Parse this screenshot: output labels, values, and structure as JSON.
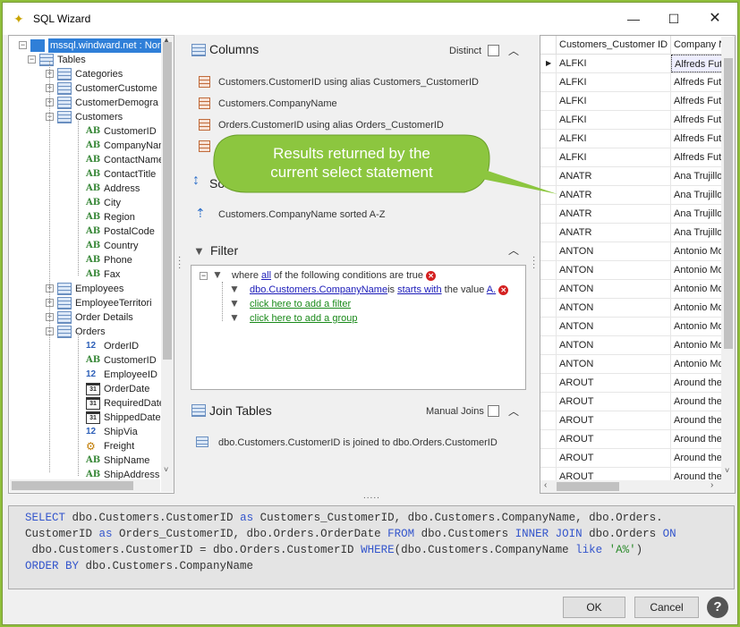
{
  "window": {
    "title": "SQL Wizard",
    "controls": [
      "minimize",
      "maximize",
      "close"
    ]
  },
  "tree": {
    "root": "mssql.windward.net : Nor",
    "tables_label": "Tables",
    "tables": [
      "Categories",
      "CustomerCustome",
      "CustomerDemogra",
      "Customers"
    ],
    "customers_columns": [
      {
        "label": "CustomerID",
        "type": "text"
      },
      {
        "label": "CompanyName",
        "type": "text"
      },
      {
        "label": "ContactName",
        "type": "text"
      },
      {
        "label": "ContactTitle",
        "type": "text"
      },
      {
        "label": "Address",
        "type": "text"
      },
      {
        "label": "City",
        "type": "text"
      },
      {
        "label": "Region",
        "type": "text"
      },
      {
        "label": "PostalCode",
        "type": "text"
      },
      {
        "label": "Country",
        "type": "text"
      },
      {
        "label": "Phone",
        "type": "text"
      },
      {
        "label": "Fax",
        "type": "text"
      }
    ],
    "tables_after": [
      "Employees",
      "EmployeeTerritori",
      "Order Details",
      "Orders"
    ],
    "orders_columns": [
      {
        "label": "OrderID",
        "type": "number"
      },
      {
        "label": "CustomerID",
        "type": "text"
      },
      {
        "label": "EmployeeID",
        "type": "number"
      },
      {
        "label": "OrderDate",
        "type": "date"
      },
      {
        "label": "RequiredDate",
        "type": "date"
      },
      {
        "label": "ShippedDate",
        "type": "date"
      },
      {
        "label": "ShipVia",
        "type": "number"
      },
      {
        "label": "Freight",
        "type": "money"
      },
      {
        "label": "ShipName",
        "type": "text"
      },
      {
        "label": "ShipAddress",
        "type": "text"
      }
    ]
  },
  "columns": {
    "heading": "Columns",
    "distinct_label": "Distinct",
    "items": [
      "Customers.CustomerID using alias Customers_CustomerID",
      "Customers.CompanyName",
      "Orders.CustomerID using alias Orders_CustomerID",
      "O"
    ]
  },
  "sort": {
    "heading": "So",
    "item": "Customers.CompanyName sorted A-Z"
  },
  "filter": {
    "heading": "Filter",
    "where_prefix": "where",
    "where_all": "all",
    "where_suffix": "of the following conditions are true",
    "condition_field": "dbo.Customers.CompanyName",
    "condition_is": "is",
    "condition_op": "starts with",
    "condition_value_prefix": "the value",
    "condition_value": "A.",
    "add_filter": "click here to add a filter",
    "add_group": "click here to add a group"
  },
  "join": {
    "heading": "Join Tables",
    "manual_label": "Manual Joins",
    "item": "dbo.Customers.CustomerID is joined to dbo.Orders.CustomerID"
  },
  "grid": {
    "headers": [
      "Customers_Customer ID",
      "Company Nam"
    ],
    "rows": [
      [
        "ALFKI",
        "Alfreds Fut"
      ],
      [
        "ALFKI",
        "Alfreds Fut"
      ],
      [
        "ALFKI",
        "Alfreds Fut"
      ],
      [
        "ALFKI",
        "Alfreds Fut"
      ],
      [
        "ALFKI",
        "Alfreds Fut"
      ],
      [
        "ALFKI",
        "Alfreds Fut"
      ],
      [
        "ANATR",
        "Ana Trujillo"
      ],
      [
        "ANATR",
        "Ana Trujillo"
      ],
      [
        "ANATR",
        "Ana Trujillo"
      ],
      [
        "ANATR",
        "Ana Trujillo"
      ],
      [
        "ANTON",
        "Antonio Mo"
      ],
      [
        "ANTON",
        "Antonio Mo"
      ],
      [
        "ANTON",
        "Antonio Mo"
      ],
      [
        "ANTON",
        "Antonio Mo"
      ],
      [
        "ANTON",
        "Antonio Mo"
      ],
      [
        "ANTON",
        "Antonio Mo"
      ],
      [
        "ANTON",
        "Antonio Mo"
      ],
      [
        "AROUT",
        "Around the"
      ],
      [
        "AROUT",
        "Around the"
      ],
      [
        "AROUT",
        "Around the"
      ],
      [
        "AROUT",
        "Around the"
      ],
      [
        "AROUT",
        "Around the"
      ],
      [
        "AROUT",
        "Around the"
      ]
    ]
  },
  "callout": {
    "line1": "Results returned by the",
    "line2": "current select statement",
    "color": "#8cc63f"
  },
  "sql": {
    "line1": [
      [
        "kw",
        "SELECT"
      ],
      [
        "t",
        " dbo.Customers.CustomerID "
      ],
      [
        "kw",
        "as"
      ],
      [
        "t",
        " Customers_CustomerID, dbo.Customers.CompanyName, dbo.Orders."
      ]
    ],
    "line2": [
      [
        "t",
        "CustomerID "
      ],
      [
        "kw",
        "as"
      ],
      [
        "t",
        " Orders_CustomerID, dbo.Orders.OrderDate "
      ],
      [
        "kw",
        "FROM"
      ],
      [
        "t",
        " dbo.Customers "
      ],
      [
        "kw",
        "INNER JOIN"
      ],
      [
        "t",
        " dbo.Orders "
      ],
      [
        "kw",
        "ON"
      ]
    ],
    "line3": [
      [
        "t",
        " dbo.Customers.CustomerID = dbo.Orders.CustomerID "
      ],
      [
        "kw",
        "WHERE"
      ],
      [
        "t",
        "(dbo.Customers.CompanyName "
      ],
      [
        "kw",
        "like"
      ],
      [
        "t",
        " "
      ],
      [
        "st",
        "'A%'"
      ],
      [
        "t",
        ")"
      ]
    ],
    "line4": [
      [
        "kw",
        "ORDER BY"
      ],
      [
        "t",
        " dbo.Customers.CompanyName"
      ]
    ]
  },
  "buttons": {
    "ok": "OK",
    "cancel": "Cancel",
    "help": "?"
  },
  "splitter": "....."
}
